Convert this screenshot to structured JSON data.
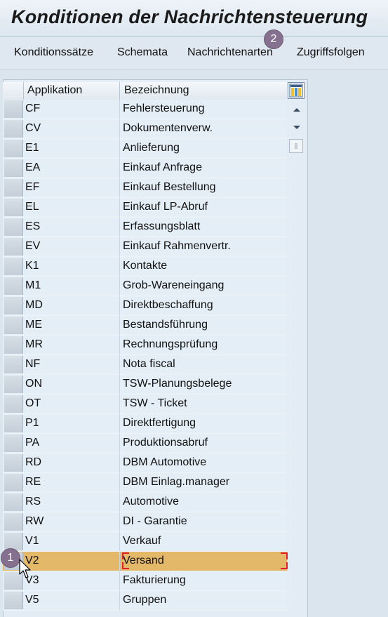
{
  "title": "Konditionen der Nachrichtensteuerung",
  "toolbar": {
    "buttons": [
      {
        "label": "Konditionssätze"
      },
      {
        "label": "Schemata"
      },
      {
        "label": "Nachrichtenarten"
      },
      {
        "label": "Zugriffsfolgen"
      }
    ]
  },
  "table": {
    "headers": [
      "Applikation",
      "Bezeichnung"
    ],
    "rows": [
      {
        "app": "CF",
        "desc": "Fehlersteuerung"
      },
      {
        "app": "CV",
        "desc": "Dokumentenverw."
      },
      {
        "app": "E1",
        "desc": "Anlieferung"
      },
      {
        "app": "EA",
        "desc": "Einkauf Anfrage"
      },
      {
        "app": "EF",
        "desc": "Einkauf Bestellung"
      },
      {
        "app": "EL",
        "desc": "Einkauf LP-Abruf"
      },
      {
        "app": "ES",
        "desc": "Erfassungsblatt"
      },
      {
        "app": "EV",
        "desc": "Einkauf Rahmenvertr."
      },
      {
        "app": "K1",
        "desc": "Kontakte"
      },
      {
        "app": "M1",
        "desc": "Grob-Wareneingang"
      },
      {
        "app": "MD",
        "desc": "Direktbeschaffung"
      },
      {
        "app": "ME",
        "desc": "Bestandsführung"
      },
      {
        "app": "MR",
        "desc": "Rechnungsprüfung"
      },
      {
        "app": "NF",
        "desc": "Nota fiscal"
      },
      {
        "app": "ON",
        "desc": "TSW-Planungsbelege"
      },
      {
        "app": "OT",
        "desc": "TSW - Ticket"
      },
      {
        "app": "P1",
        "desc": "Direktfertigung"
      },
      {
        "app": "PA",
        "desc": "Produktionsabruf"
      },
      {
        "app": "RD",
        "desc": "DBM Automotive"
      },
      {
        "app": "RE",
        "desc": "DBM Einlag.manager"
      },
      {
        "app": "RS",
        "desc": "Automotive"
      },
      {
        "app": "RW",
        "desc": "DI - Garantie"
      },
      {
        "app": "V1",
        "desc": "Verkauf"
      },
      {
        "app": "V2",
        "desc": "Versand",
        "selected": true
      },
      {
        "app": "V3",
        "desc": "Fakturierung"
      },
      {
        "app": "V5",
        "desc": "Gruppen"
      }
    ]
  },
  "badges": {
    "step1": "1",
    "step2": "2"
  },
  "colors": {
    "selected_row": "#e3b969",
    "focus_border": "#e0202a",
    "badge": "#86708f",
    "background": "#dbe5ee"
  },
  "icons": {
    "column_config": "table-settings-icon",
    "scroll_up": "arrow-up-icon",
    "scroll_down": "arrow-down-icon",
    "cursor": "mouse-pointer-icon"
  }
}
